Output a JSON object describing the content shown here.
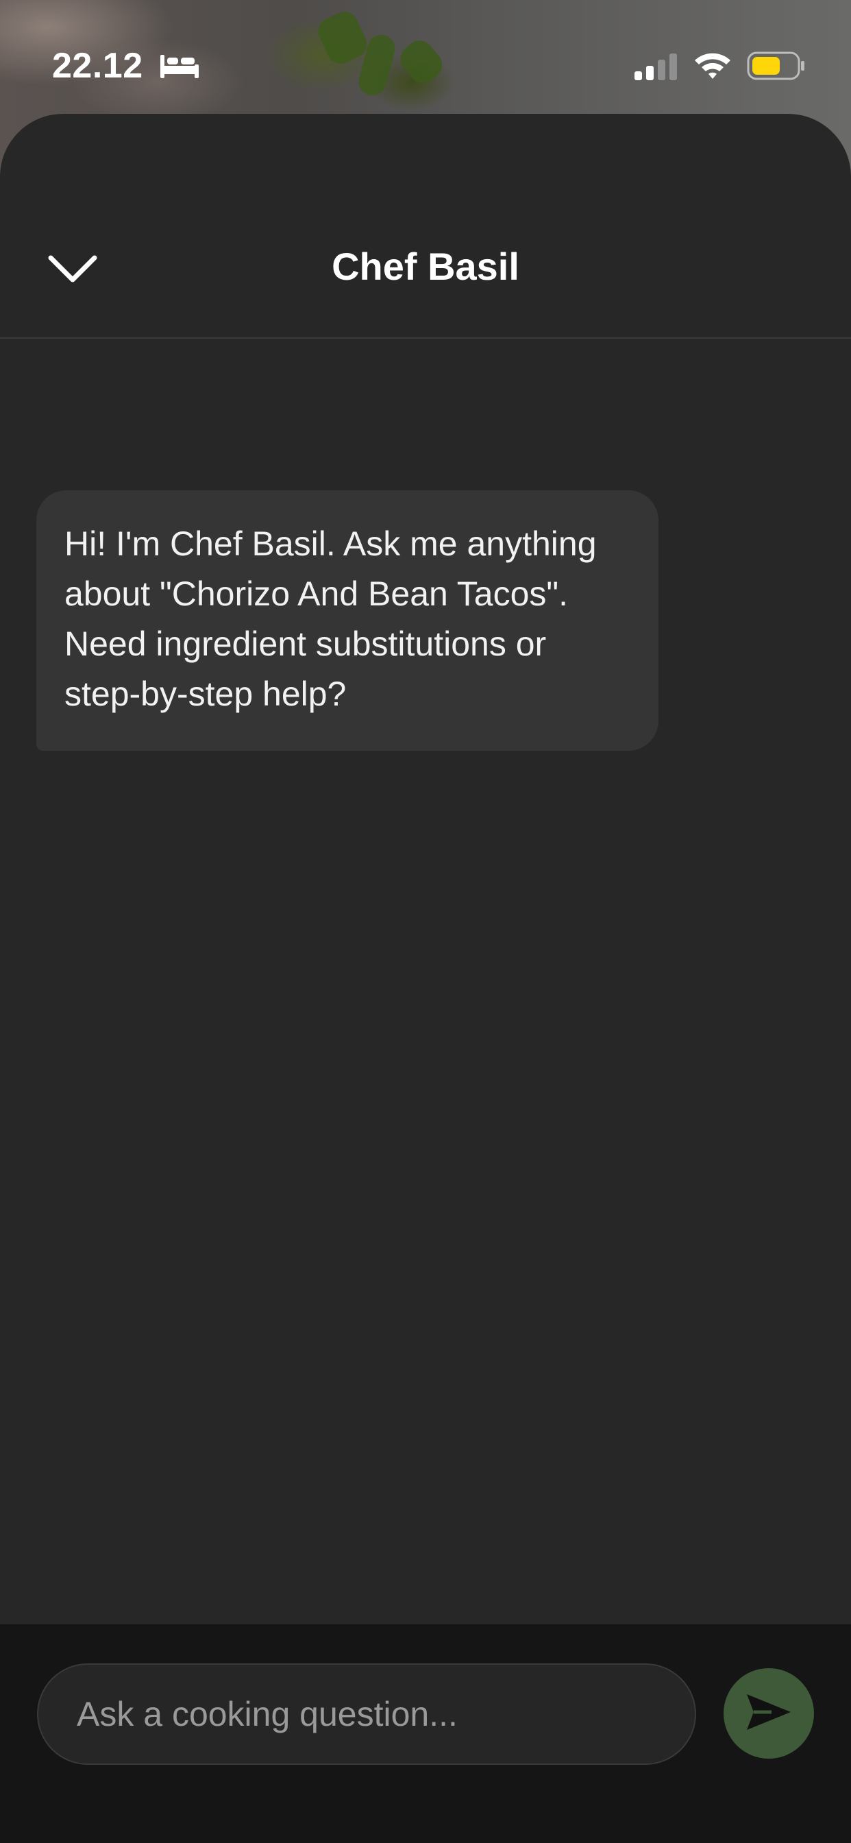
{
  "status_bar": {
    "time": "22.12",
    "icons": [
      "bed-icon",
      "signal-icon",
      "wifi-icon",
      "battery-icon"
    ],
    "battery_color": "#ffd60a"
  },
  "header": {
    "title": "Chef Basil",
    "collapse_icon": "chevron-down-icon"
  },
  "messages": [
    {
      "sender": "assistant",
      "text": "Hi! I'm Chef Basil. Ask me anything about \"Chorizo And Bean Tacos\". Need ingredient substitutions or step-by-step help?"
    }
  ],
  "composer": {
    "placeholder": "Ask a cooking question...",
    "value": "",
    "send_icon": "send-icon"
  },
  "colors": {
    "sheet_background": "#272727",
    "bubble_background": "#353535",
    "input_bar_background": "#151515",
    "send_button": "#3f5a38"
  }
}
